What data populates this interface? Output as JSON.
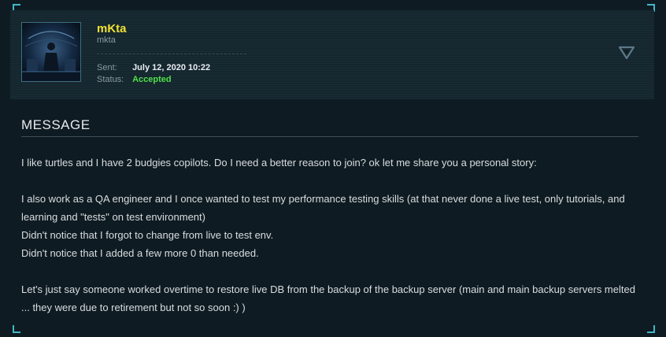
{
  "sender": {
    "name": "mKta",
    "handle": "mkta"
  },
  "meta": {
    "sent_label": "Sent:",
    "sent_value": "July 12, 2020 10:22",
    "status_label": "Status:",
    "status_value": "Accepted"
  },
  "icons": {
    "toggle": "triangle-down-icon",
    "avatar": "avatar-image"
  },
  "colors": {
    "name": "#f2e233",
    "accepted": "#4ee04a",
    "accent_corner": "#3fb8c8",
    "background": "#0f1b22"
  },
  "message": {
    "heading": "MESSAGE",
    "lines": [
      "I like turtles and I have 2 budgies copilots. Do I need a better reason to join? ok let me share you a personal story:",
      "",
      "I also work as a QA engineer and I once wanted to test my performance testing skills (at that never done a live test, only tutorials, and learning and \"tests\" on test environment)",
      "Didn't notice that I forgot to change from live to test env.",
      "Didn't notice that I added a few more 0 than needed.",
      "",
      "Let's just say someone worked overtime to restore live DB from the backup of the backup server (main and main backup servers melted ... they were due to retirement but not so soon :) )"
    ]
  }
}
